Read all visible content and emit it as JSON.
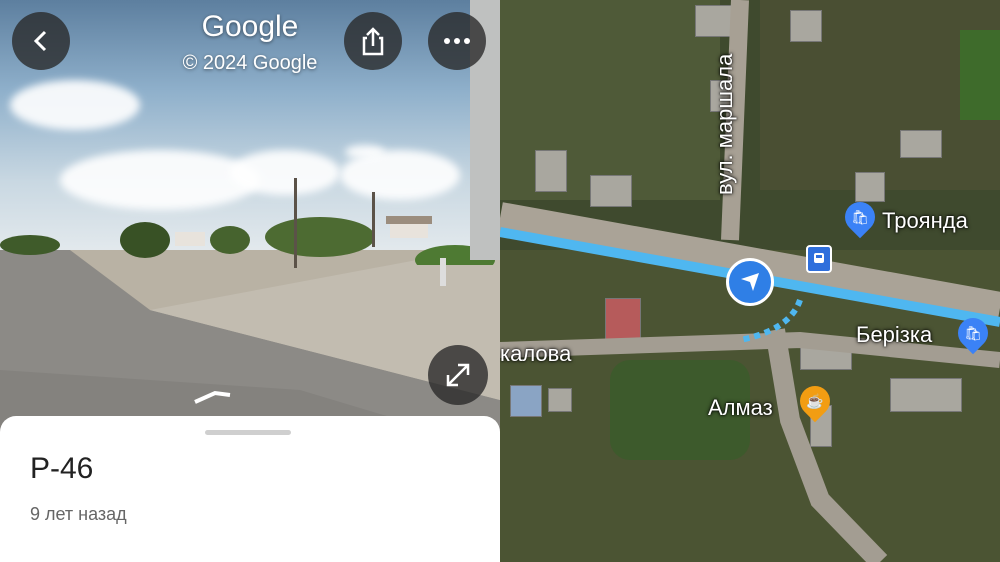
{
  "street_view": {
    "title": "Google",
    "copyright": "© 2024 Google",
    "place_name": "P-46",
    "time_ago": "9 лет назад"
  },
  "map": {
    "streets": {
      "marshala": "вул. маршала",
      "kalova": "калова"
    },
    "pois": {
      "troyanda": "Троянда",
      "berizka": "Берізка",
      "almaz": "Алмаз"
    }
  },
  "colors": {
    "route": "#4fb7f0",
    "location_arrow": "#2f7fe6",
    "poi_shop": "#3b82f6",
    "poi_cafe": "#f29d12",
    "bus_stop": "#2f6fdc"
  }
}
